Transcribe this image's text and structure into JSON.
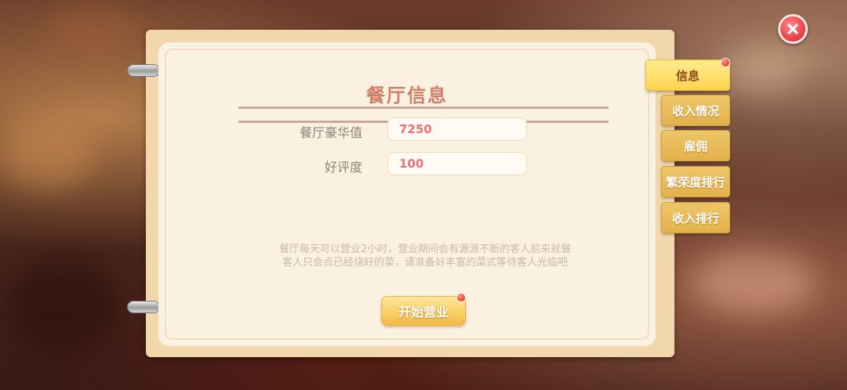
{
  "close_button": {
    "icon": "close-icon",
    "color": "#f0484f"
  },
  "panel": {
    "title": "餐厅信息",
    "fields": [
      {
        "label": "餐厅豪华值",
        "value": "7250"
      },
      {
        "label": "好评度",
        "value": "100"
      }
    ],
    "description_lines": [
      "餐厅每天可以营业2小时，营业期间会有源源不断的客人前来就餐",
      "客人只会点已经烧好的菜，请准备好丰富的菜式等待客人光临吧"
    ],
    "start_button": {
      "label": "开始营业",
      "has_notification": true
    }
  },
  "tabs": [
    {
      "label": "信息",
      "active": true,
      "has_notification": true
    },
    {
      "label": "收入情况",
      "active": false
    },
    {
      "label": "雇佣",
      "active": false
    },
    {
      "label": "繁荣度排行",
      "active": false
    },
    {
      "label": "收入排行",
      "active": false
    }
  ],
  "colors": {
    "accent": "#f0b93a",
    "title": "#cf7e69",
    "value_text": "#f06f79"
  }
}
